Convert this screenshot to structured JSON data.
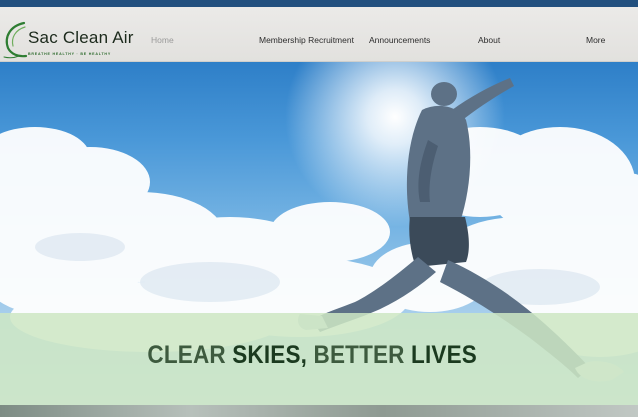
{
  "brand": {
    "name": "Sac Clean Air",
    "tagline": "BREATHE HEALTHY · BE HEALTHY",
    "swoosh_color": "#2e7d32"
  },
  "nav": {
    "items": [
      {
        "label": "Home",
        "active": true
      },
      {
        "label": "Membership Recruitment",
        "active": false
      },
      {
        "label": "Announcements",
        "active": false
      },
      {
        "label": "About",
        "active": false
      },
      {
        "label": "More",
        "active": false
      }
    ]
  },
  "hero": {
    "headline_words": [
      "CLEAR",
      "SKIES,",
      "BETTER",
      "LIVES"
    ],
    "band_color": "#cde6c4",
    "sky_color": "#4a98d8"
  }
}
